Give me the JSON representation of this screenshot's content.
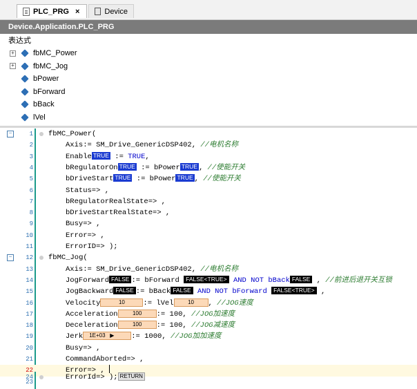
{
  "tabs": [
    {
      "label": "PLC_PRG",
      "active": true,
      "icon": "document-icon",
      "close": "×"
    },
    {
      "label": "Device",
      "active": false,
      "icon": "device-icon"
    }
  ],
  "path": "Device.Application.PLC_PRG",
  "watch": {
    "header": "表达式",
    "items": [
      {
        "label": "fbMC_Power",
        "expandable": true
      },
      {
        "label": "fbMC_Jog",
        "expandable": true
      },
      {
        "label": "bPower",
        "expandable": false
      },
      {
        "label": "bForward",
        "expandable": false
      },
      {
        "label": "bBack",
        "expandable": false
      },
      {
        "label": "lVel",
        "expandable": false
      }
    ]
  },
  "code": {
    "l1": "fbMC_Power(",
    "l2a": "Axis:= SM_Drive_GenericDSP402, ",
    "l2c": "//电机名称",
    "l3a": "Enable",
    "l3b": ":= ",
    "l3c": "TRUE",
    "l3d": ",",
    "l4a": "bRegulatorOn",
    "l4b": ":= bPower",
    "l4c": ", ",
    "l4d": "//使能开关",
    "l5a": "bDriveStart",
    "l5b": ":= bPower",
    "l5c": ", ",
    "l5d": "//使能开关",
    "l6": "Status=> ,",
    "l7": "bRegulatorRealState=> ,",
    "l8": "bDriveStartRealState=> ,",
    "l9": "Busy=> ,",
    "l10": "Error=> ,",
    "l11": "ErrorID=> );",
    "l12": "fbMC_Jog(",
    "l13a": "Axis:= SM_Drive_GenericDSP402, ",
    "l13c": "//电机名称",
    "l14a": "JogForward",
    "l14b": ":= bForward",
    "l14c": " AND NOT bBack",
    "l14d": " , ",
    "l14e": "//前进后退开关互锁",
    "l15a": "JogBackward",
    "l15b": ":= bBack",
    "l15c": " AND NOT bForward",
    "l15d": " ,",
    "l16a": "Velocity",
    "l16b": ":= lVel",
    "l16c": ", ",
    "l16d": "//JOG速度",
    "l17a": "Acceleration",
    "l17b": ":= 100, ",
    "l17c": "//JOG加速度",
    "l18a": "Deceleration",
    "l18b": ":= 100, ",
    "l18c": "//JOG减速度",
    "l19a": "Jerk",
    "l19b": ":= 1000, ",
    "l19c": "//JOG加加速度",
    "l20": "Busy=> ,",
    "l21": "CommandAborted=> ,",
    "l22": "Error=> , ",
    "l24": "ErrorId=> );"
  },
  "monitor": {
    "true": "TRUE",
    "false": "FALSE",
    "false_true": "FALSE<TRUE>",
    "velocity": "10",
    "lvel": "10",
    "accel": "100",
    "decel": "100",
    "jerk": "1E+03",
    "jerk_arrow": "▶",
    "return": "RETURN"
  },
  "line_numbers": [
    "1",
    "2",
    "3",
    "4",
    "5",
    "6",
    "7",
    "8",
    "9",
    "10",
    "11",
    "12",
    "13",
    "14",
    "15",
    "16",
    "17",
    "18",
    "19",
    "20",
    "21",
    "22",
    "23",
    "24"
  ],
  "colors": {
    "accent_blue": "#1a3bd1",
    "comment_green": "#2e7d32",
    "path_bar": "#7b7b7b",
    "gutter": "#1a9a8a"
  }
}
